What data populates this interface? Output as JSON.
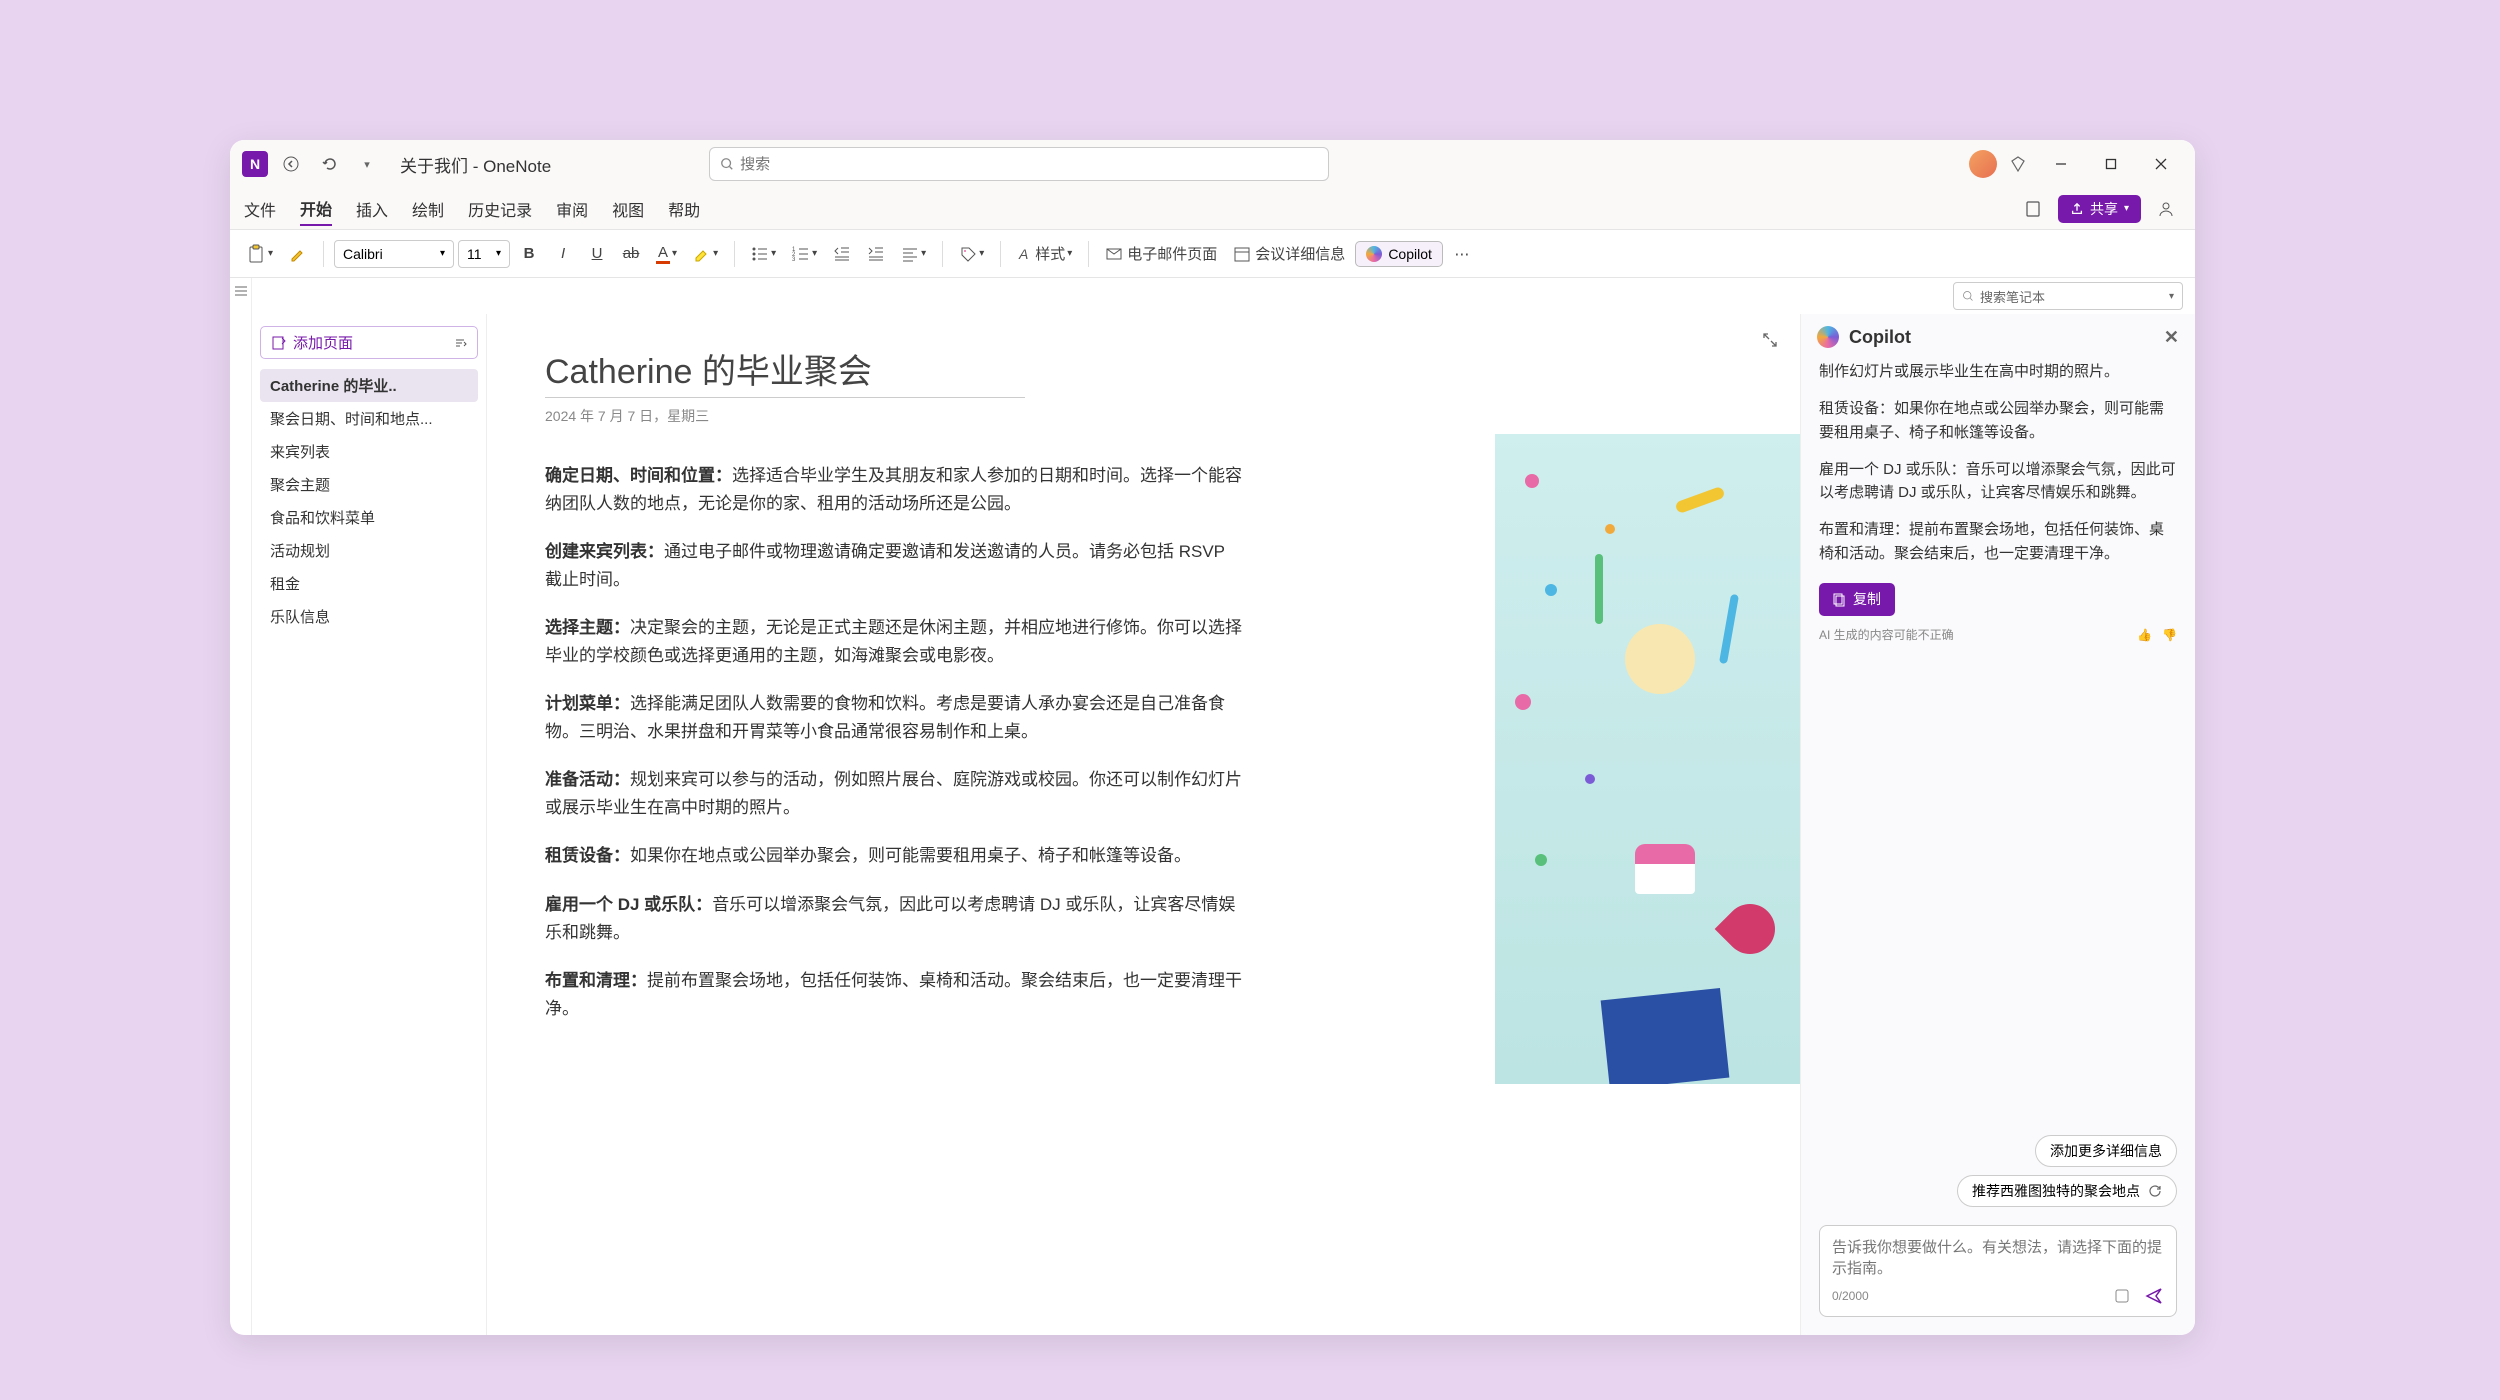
{
  "titlebar": {
    "app_title": "关于我们 - OneNote",
    "search_placeholder": "搜索"
  },
  "tabs": {
    "items": [
      "文件",
      "开始",
      "插入",
      "绘制",
      "历史记录",
      "审阅",
      "视图",
      "帮助"
    ],
    "active_index": 1,
    "share_label": "共享"
  },
  "ribbon": {
    "font_name": "Calibri",
    "font_size": "11",
    "style_label": "样式",
    "email_page_label": "电子邮件页面",
    "meeting_label": "会议详细信息",
    "copilot_label": "Copilot"
  },
  "notebook_search_placeholder": "搜索笔记本",
  "sidebar": {
    "add_page_label": "添加页面",
    "pages": [
      "Catherine 的毕业..",
      "聚会日期、时间和地点...",
      "来宾列表",
      "聚会主题",
      "食品和饮料菜单",
      "活动规划",
      "租金",
      "乐队信息"
    ]
  },
  "note": {
    "title": "Catherine 的毕业聚会",
    "date": "2024 年 7 月 7 日，星期三",
    "paragraphs": [
      {
        "b": "确定日期、时间和位置：",
        "t": "选择适合毕业学生及其朋友和家人参加的日期和时间。选择一个能容纳团队人数的地点，无论是你的家、租用的活动场所还是公园。"
      },
      {
        "b": "创建来宾列表：",
        "t": "通过电子邮件或物理邀请确定要邀请和发送邀请的人员。请务必包括 RSVP 截止时间。"
      },
      {
        "b": "选择主题：",
        "t": "决定聚会的主题，无论是正式主题还是休闲主题，并相应地进行修饰。你可以选择毕业的学校颜色或选择更通用的主题，如海滩聚会或电影夜。"
      },
      {
        "b": "计划菜单：",
        "t": "选择能满足团队人数需要的食物和饮料。考虑是要请人承办宴会还是自己准备食物。三明治、水果拼盘和开胃菜等小食品通常很容易制作和上桌。"
      },
      {
        "b": "准备活动：",
        "t": "规划来宾可以参与的活动，例如照片展台、庭院游戏或校园。你还可以制作幻灯片或展示毕业生在高中时期的照片。"
      },
      {
        "b": "租赁设备：",
        "t": "如果你在地点或公园举办聚会，则可能需要租用桌子、椅子和帐篷等设备。"
      },
      {
        "b": "雇用一个 DJ 或乐队：",
        "t": "音乐可以增添聚会气氛，因此可以考虑聘请 DJ 或乐队，让宾客尽情娱乐和跳舞。"
      },
      {
        "b": "布置和清理：",
        "t": "提前布置聚会场地，包括任何装饰、桌椅和活动。聚会结束后，也一定要清理干净。"
      }
    ]
  },
  "copilot": {
    "header": "Copilot",
    "messages": [
      "制作幻灯片或展示毕业生在高中时期的照片。",
      "租赁设备：如果你在地点或公园举办聚会，则可能需要租用桌子、椅子和帐篷等设备。",
      "雇用一个 DJ 或乐队：音乐可以增添聚会气氛，因此可以考虑聘请 DJ 或乐队，让宾客尽情娱乐和跳舞。",
      "布置和清理：提前布置聚会场地，包括任何装饰、桌椅和活动。聚会结束后，也一定要清理干净。"
    ],
    "copy_label": "复制",
    "disclaimer": "AI 生成的内容可能不正确",
    "suggestions": [
      "添加更多详细信息",
      "推荐西雅图独特的聚会地点"
    ],
    "input_placeholder": "告诉我你想要做什么。有关想法，请选择下面的提示指南。",
    "char_count": "0/2000"
  }
}
